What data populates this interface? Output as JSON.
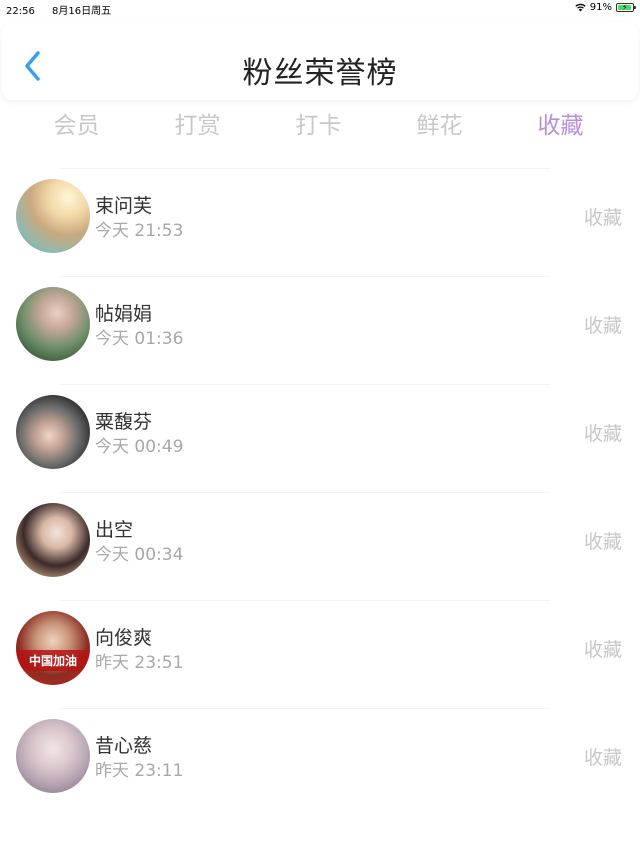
{
  "status_bar": {
    "time": "22:56",
    "date": "8月16日周五",
    "battery_percent": "91%",
    "battery_level": 0.91,
    "wifi_icon": "wifi-icon",
    "battery_icon": "battery-charging-icon"
  },
  "header": {
    "title": "粉丝荣誉榜",
    "back_icon": "chevron-left-icon",
    "accent_color": "#3a9ef0"
  },
  "tabs": [
    {
      "label": "会员",
      "active": false
    },
    {
      "label": "打赏",
      "active": false
    },
    {
      "label": "打卡",
      "active": false
    },
    {
      "label": "鲜花",
      "active": false
    },
    {
      "label": "收藏",
      "active": true
    }
  ],
  "active_tab_color": "#b78fe0",
  "fans": [
    {
      "name": "束问芙",
      "time": "今天 21:53",
      "action": "收藏"
    },
    {
      "name": "帖娟娟",
      "time": "今天 01:36",
      "action": "收藏"
    },
    {
      "name": "粟馥芬",
      "time": "今天 00:49",
      "action": "收藏"
    },
    {
      "name": "出空",
      "time": "今天 00:34",
      "action": "收藏"
    },
    {
      "name": "向俊爽",
      "time": "昨天 23:51",
      "action": "收藏",
      "avatar_text": "中国加油"
    },
    {
      "name": "昔心慈",
      "time": "昨天 23:11",
      "action": "收藏"
    }
  ]
}
